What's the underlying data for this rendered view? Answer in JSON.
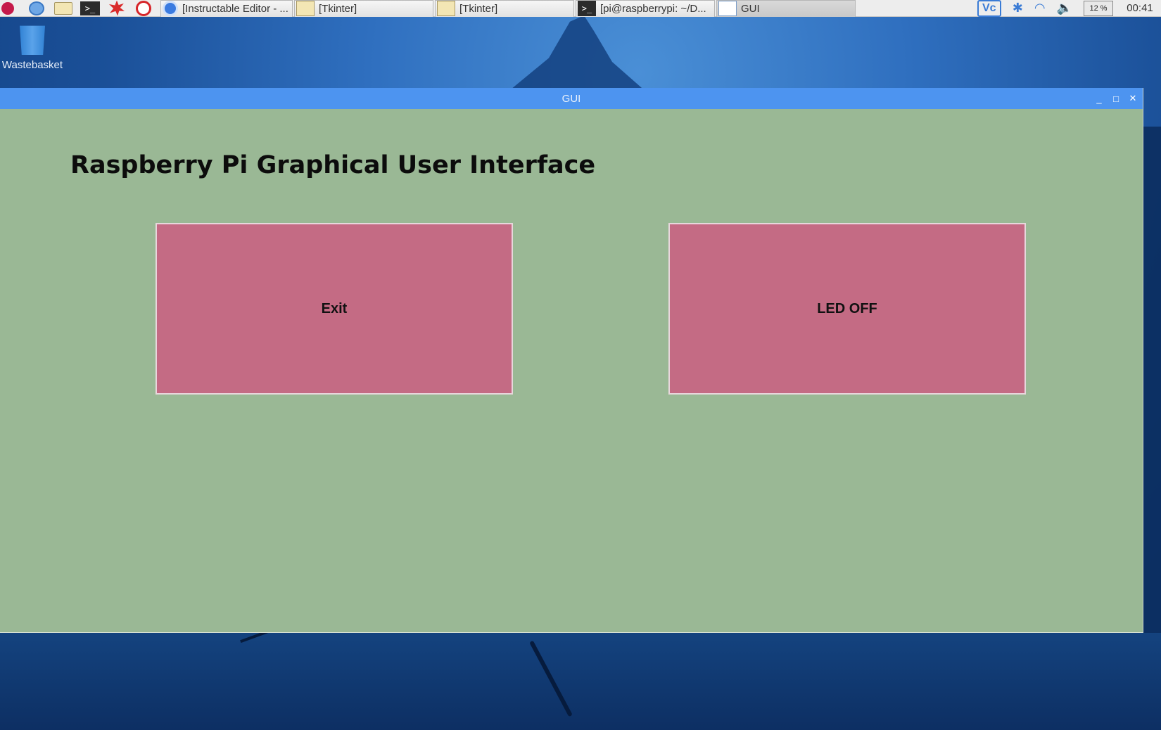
{
  "taskbar": {
    "launchers": [
      {
        "icon": "raspberry-menu-icon"
      },
      {
        "icon": "globe-browser-icon"
      },
      {
        "icon": "file-manager-icon"
      },
      {
        "icon": "terminal-icon",
        "glyph": ">_"
      },
      {
        "icon": "mathematica-icon"
      },
      {
        "icon": "wolfram-icon"
      }
    ],
    "tasks": [
      {
        "label": "[Instructable Editor - ...",
        "icon": "chrome-icon"
      },
      {
        "label": "[Tkinter]",
        "icon": "text-editor-icon"
      },
      {
        "label": "[Tkinter]",
        "icon": "text-editor-icon"
      },
      {
        "label": "[pi@raspberrypi: ~/D...",
        "icon": "terminal-icon",
        "glyph": ">_"
      },
      {
        "label": "GUI",
        "icon": "window-icon"
      }
    ],
    "tray": {
      "vnc": "Vc",
      "bluetooth_glyph": "✱",
      "wifi_glyph": "◠",
      "volume_glyph": "🔈",
      "cpu": "12 %",
      "clock": "00:41"
    }
  },
  "desktop": {
    "icons": [
      {
        "label": "Wastebasket",
        "icon": "trash-icon"
      }
    ]
  },
  "window": {
    "title": "GUI",
    "controls": {
      "minimize": "_",
      "maximize": "□",
      "close": "✕"
    },
    "heading": "Raspberry Pi Graphical User Interface",
    "buttons": {
      "exit": "Exit",
      "led": "LED OFF"
    },
    "colors": {
      "background": "#9ab895",
      "button": "#c46b84",
      "titlebar": "#4d94f0"
    }
  }
}
